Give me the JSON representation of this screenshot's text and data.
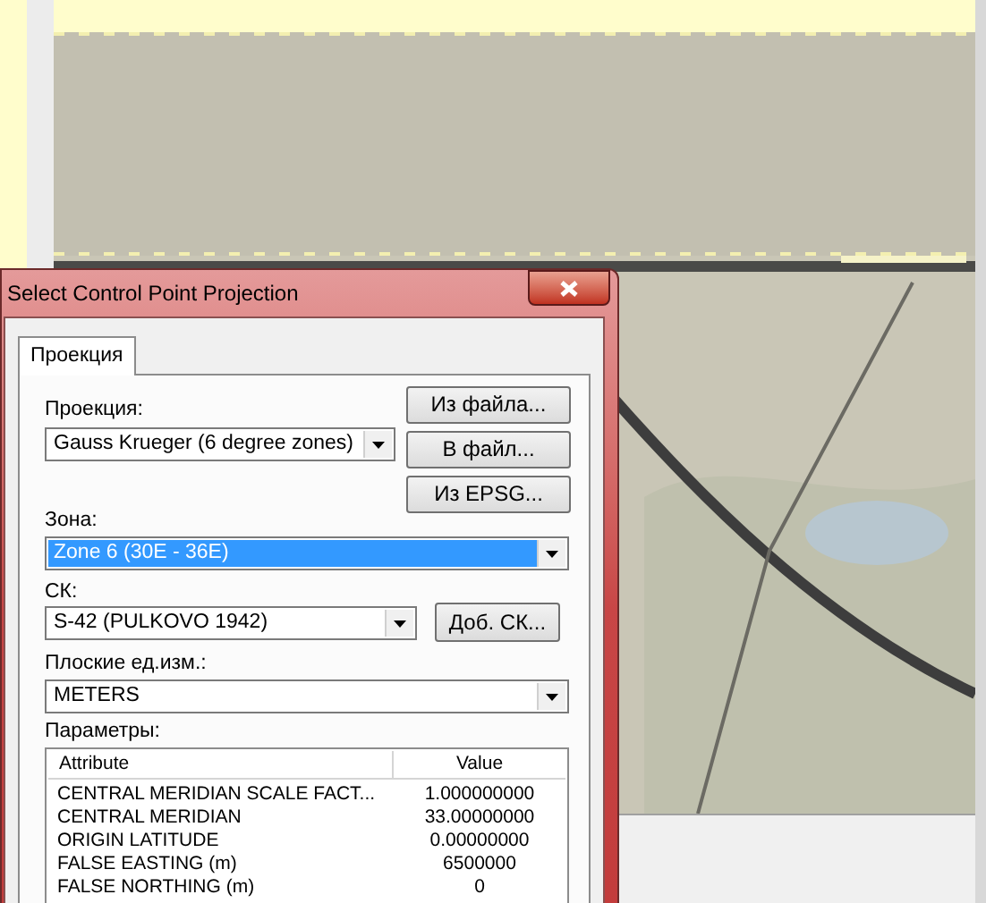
{
  "window": {
    "title": "Select Control Point Projection"
  },
  "tabs": [
    {
      "label": "Проекция",
      "selected": true
    }
  ],
  "projection": {
    "label": "Проекция:",
    "value": "Gauss Krueger (6 degree zones)"
  },
  "file_buttons": [
    "Из файла...",
    "В файл...",
    "Из EPSG..."
  ],
  "zone": {
    "label": "Зона:",
    "value": "Zone 6 (30E - 36E)",
    "selected": true
  },
  "cs": {
    "label": "СК:",
    "value": "S-42 (PULKOVO 1942)",
    "button": "Доб. СК..."
  },
  "units": {
    "label": "Плоские ед.изм.:",
    "value": "METERS",
    "selected": false
  },
  "parameters": {
    "label": "Параметры:",
    "columns": [
      "Attribute",
      "Value"
    ],
    "rows": [
      [
        "CENTRAL MERIDIAN SCALE FACT...",
        "1.000000000"
      ],
      [
        "CENTRAL MERIDIAN",
        "33.00000000"
      ],
      [
        "ORIGIN LATITUDE",
        "0.00000000"
      ],
      [
        "FALSE EASTING (m)",
        "6500000"
      ],
      [
        "FALSE NORTHING (m)",
        "0"
      ]
    ]
  }
}
